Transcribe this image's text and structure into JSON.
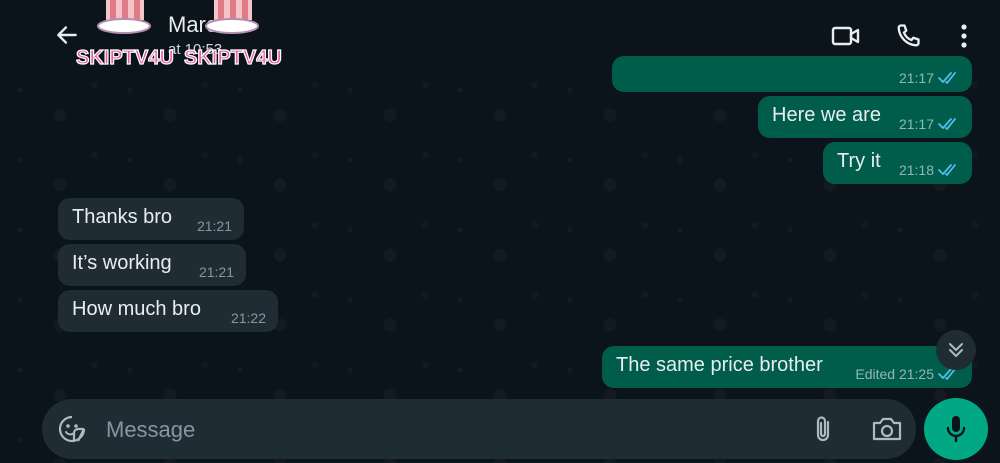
{
  "header": {
    "contact_name": "Marc",
    "status": "at 10:53",
    "sticker_text_1": "SKIPTV4U",
    "sticker_text_2": "SKIPTV4U"
  },
  "messages": [
    {
      "id": "m0",
      "direction": "outgoing",
      "text": "",
      "time": "21:17",
      "read": true,
      "partial": true
    },
    {
      "id": "m1",
      "direction": "outgoing",
      "text": "Here we are",
      "time": "21:17",
      "read": true
    },
    {
      "id": "m2",
      "direction": "outgoing",
      "text": "Try it",
      "time": "21:18",
      "read": true
    },
    {
      "id": "m3",
      "direction": "incoming",
      "text": "Thanks bro",
      "time": "21:21"
    },
    {
      "id": "m4",
      "direction": "incoming",
      "text": "It’s working",
      "time": "21:21"
    },
    {
      "id": "m5",
      "direction": "incoming",
      "text": "How much bro",
      "time": "21:22"
    },
    {
      "id": "m6",
      "direction": "outgoing",
      "text": "The same price brother",
      "time": "Edited 21:25",
      "read": true
    }
  ],
  "composer": {
    "placeholder": "Message"
  },
  "icons": {
    "back": "arrow-left-icon",
    "video": "video-camera-icon",
    "call": "phone-icon",
    "menu": "more-vertical-icon",
    "emoji": "sticker-smiley-icon",
    "attach": "paperclip-icon",
    "camera": "camera-icon",
    "mic": "microphone-icon",
    "scroll": "double-chevron-down-icon"
  },
  "colors": {
    "background": "#0b141a",
    "outgoing_bubble": "#005c4b",
    "incoming_bubble": "#202c33",
    "accent": "#00a884",
    "read_ticks": "#53bdeb"
  }
}
